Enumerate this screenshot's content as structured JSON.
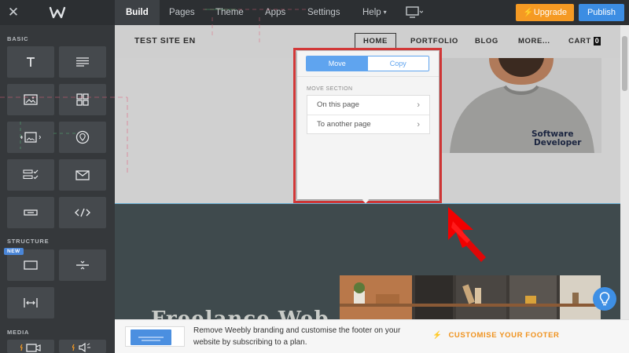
{
  "topbar": {
    "nav": [
      {
        "label": "Build",
        "active": true
      },
      {
        "label": "Pages",
        "active": false
      },
      {
        "label": "Theme",
        "active": false
      },
      {
        "label": "Apps",
        "active": false
      },
      {
        "label": "Settings",
        "active": false
      },
      {
        "label": "Help",
        "active": false
      }
    ],
    "upgrade_label": "Upgrade",
    "publish_label": "Publish",
    "colors": {
      "upgrade": "#f59a23",
      "publish": "#3c8de3",
      "bar": "#2c2f32"
    }
  },
  "sidebar": {
    "basic_label": "BASIC",
    "structure_label": "STRUCTURE",
    "media_label": "MEDIA",
    "new_badge": "NEW",
    "basic_icons": [
      "title-icon",
      "text-icon",
      "image-icon",
      "gallery-icon",
      "slideshow-icon",
      "map-pin-icon",
      "contact-form-icon",
      "mail-icon",
      "button-icon",
      "embed-code-icon"
    ],
    "structure_icons": [
      "section-icon",
      "divider-icon",
      "spacer-icon"
    ]
  },
  "site": {
    "title": "TEST SITE EN",
    "nav": [
      "HOME",
      "PORTFOLIO",
      "BLOG",
      "MORE...",
      "CART"
    ],
    "cart_count": "0",
    "shirt_text_line1": "Software",
    "shirt_text_line2": "Developer",
    "heading": "Freelance Web"
  },
  "popover": {
    "tabs": [
      "Move",
      "Copy"
    ],
    "active_tab": "Move",
    "section_label": "MOVE SECTION",
    "options": [
      "On this page",
      "To another page"
    ],
    "accent": "#5fa4ef"
  },
  "footer": {
    "message": "Remove Weebly branding and customise the footer on your website by subscribing to a plan.",
    "cta": "CUSTOMISE YOUR FOOTER",
    "cta_color": "#f0921d"
  }
}
